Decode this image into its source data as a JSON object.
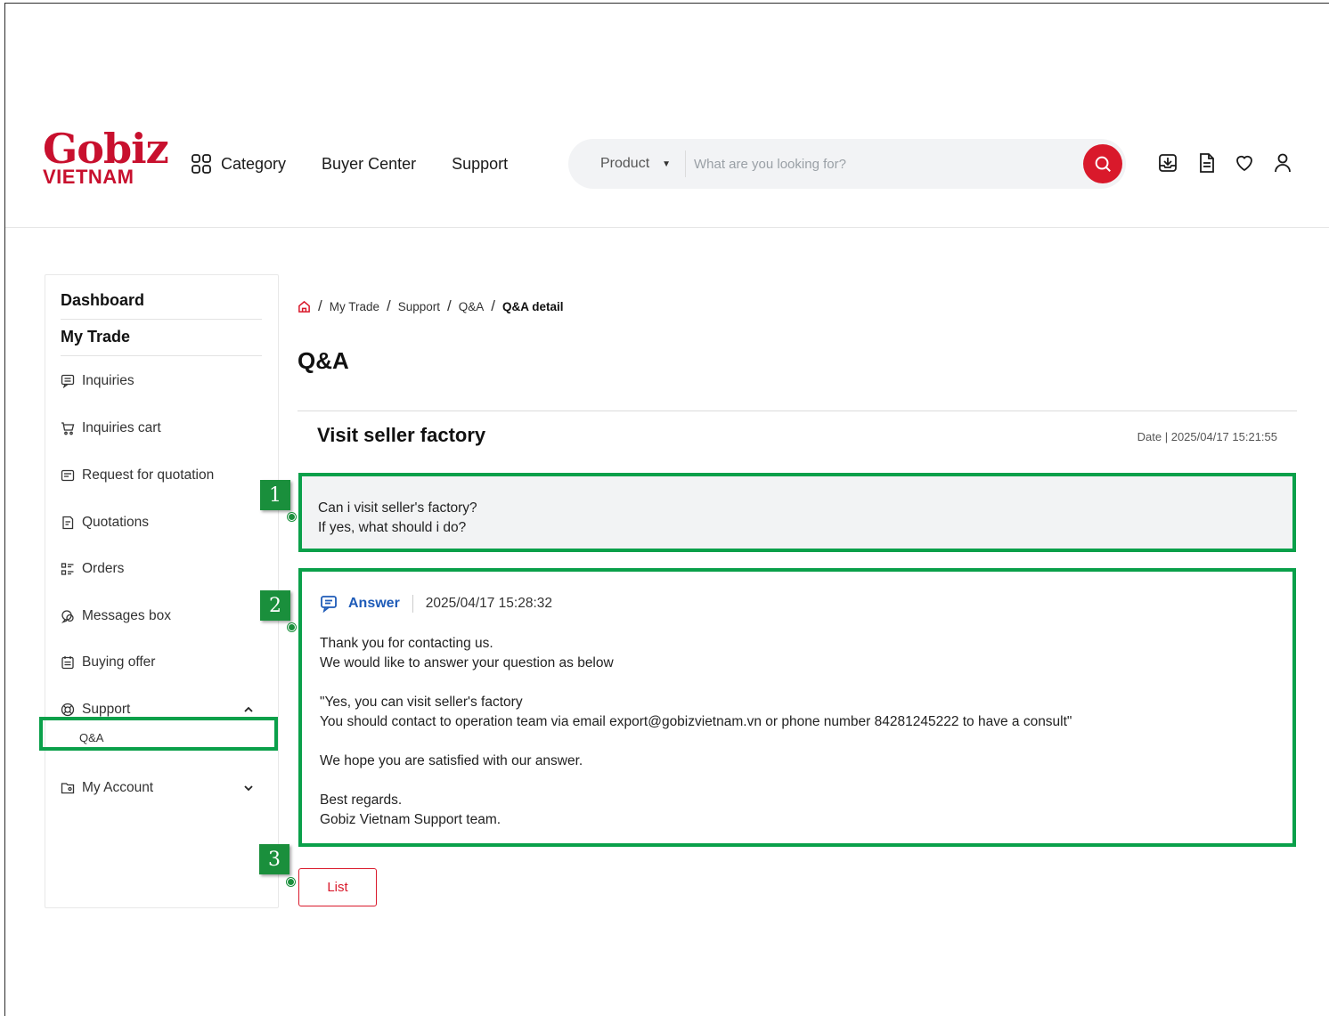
{
  "header": {
    "logo_main": "Gobiz",
    "logo_sub": "VIETNAM",
    "nav": {
      "category": "Category",
      "buyer_center": "Buyer Center",
      "support": "Support"
    },
    "search": {
      "category": "Product",
      "placeholder": "What are you looking for?"
    },
    "icons": [
      "inbox-download-icon",
      "document-icon",
      "heart-icon",
      "user-icon"
    ]
  },
  "sidebar": {
    "dashboard": "Dashboard",
    "my_trade": "My Trade",
    "items": [
      {
        "label": "Inquiries",
        "icon": "inquiries-icon"
      },
      {
        "label": "Inquiries cart",
        "icon": "cart-icon"
      },
      {
        "label": "Request for quotation",
        "icon": "quotation-request-icon"
      },
      {
        "label": "Quotations",
        "icon": "quotations-icon"
      },
      {
        "label": "Orders",
        "icon": "orders-icon"
      },
      {
        "label": "Messages box",
        "icon": "messages-icon"
      },
      {
        "label": "Buying offer",
        "icon": "buying-offer-icon"
      },
      {
        "label": "Support",
        "icon": "support-icon"
      }
    ],
    "support_sub": "Q&A",
    "my_account": "My Account"
  },
  "breadcrumb": {
    "items": [
      "My Trade",
      "Support",
      "Q&A"
    ],
    "current": "Q&A detail"
  },
  "page_title": "Q&A",
  "question": {
    "title": "Visit seller factory",
    "date": "Date | 2025/04/17 15:21:55",
    "line1": "Can i visit seller's factory?",
    "line2": "If yes, what should i do?"
  },
  "answer": {
    "label": "Answer",
    "date": "2025/04/17 15:28:32",
    "text": "Thank you for contacting us.\nWe would like to answer your question as below\n\n\"Yes, you can visit seller's factory\nYou should contact to operation team via email export@gobizvietnam.vn or phone number 84281245222 to have a consult\"\n\nWe hope you are satisfied with our answer.\n\nBest regards.\nGobiz Vietnam Support team."
  },
  "list_button": "List",
  "callouts": [
    "1",
    "2",
    "3"
  ],
  "colors": {
    "brand": "#c8102e",
    "accent_blue": "#1e5bb8",
    "highlight": "#0aa04a"
  }
}
